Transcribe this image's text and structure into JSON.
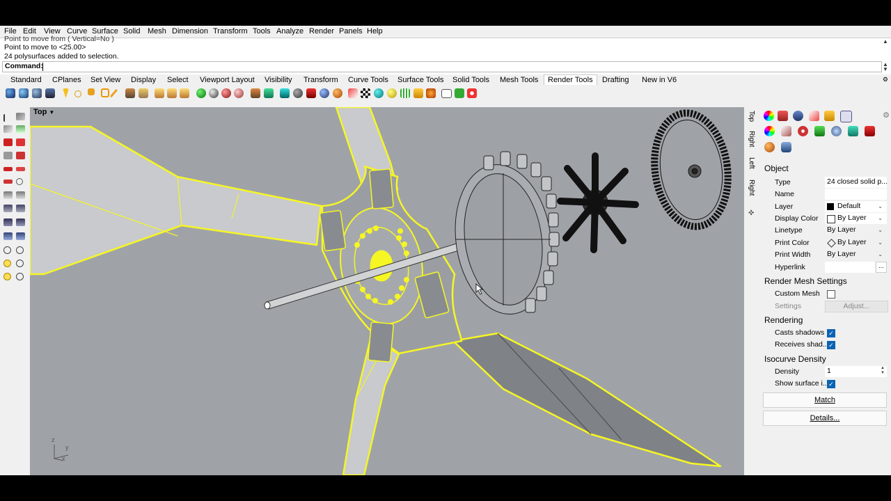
{
  "menu": [
    "File",
    "Edit",
    "View",
    "Curve",
    "Surface",
    "Solid",
    "Mesh",
    "Dimension",
    "Transform",
    "Tools",
    "Analyze",
    "Render",
    "Panels",
    "Help"
  ],
  "command": {
    "history": [
      "Point to move from ( Vertical=No )",
      "Point to move to <25.00>",
      "24 polysurfaces added to selection."
    ],
    "prompt_label": "Command:",
    "value": ""
  },
  "tabs": [
    "Standard",
    "CPlanes",
    "Set View",
    "Display",
    "Select",
    "Viewport Layout",
    "Visibility",
    "Transform",
    "Curve Tools",
    "Surface Tools",
    "Solid Tools",
    "Mesh Tools",
    "Render Tools",
    "Drafting",
    "New in V6"
  ],
  "active_tab": "Render Tools",
  "viewport": {
    "title": "Top",
    "axis_z": "z",
    "axis_y": "y",
    "axis_x": "x"
  },
  "view_tabs": [
    "Top",
    "Right",
    "Left",
    "Right"
  ],
  "properties": {
    "object_header": "Object",
    "type_label": "Type",
    "type_value": "24 closed solid p...",
    "name_label": "Name",
    "name_value": "",
    "layer_label": "Layer",
    "layer_value": "Default",
    "display_color_label": "Display Color",
    "display_color_value": "By Layer",
    "linetype_label": "Linetype",
    "linetype_value": "By Layer",
    "print_color_label": "Print Color",
    "print_color_value": "By Layer",
    "print_width_label": "Print Width",
    "print_width_value": "By Layer",
    "hyperlink_label": "Hyperlink",
    "hyperlink_value": "",
    "hyperlink_button": "...",
    "render_mesh_header": "Render Mesh Settings",
    "custom_mesh_label": "Custom Mesh",
    "settings_label": "Settings",
    "adjust_button": "Adjust...",
    "rendering_header": "Rendering",
    "casts_shadows_label": "Casts shadows",
    "receives_shadows_label": "Receives shad...",
    "isocurve_header": "Isocurve Density",
    "density_label": "Density",
    "density_value": "1",
    "show_surface_label": "Show surface i...",
    "match_button": "Match",
    "details_button": "Details..."
  },
  "colors": {
    "selection": "#ffff22",
    "viewport_bg": "#9fa3a8",
    "accent": "#0a64b4"
  }
}
